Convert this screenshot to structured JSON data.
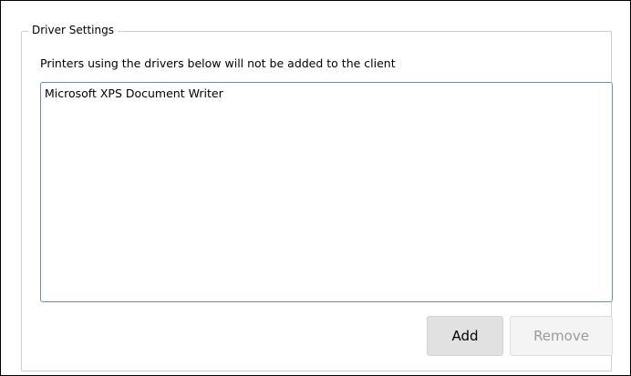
{
  "group": {
    "title": "Driver Settings",
    "description": "Printers using the drivers below will not be added to the client"
  },
  "driver_list": {
    "items": [
      "Microsoft XPS Document Writer"
    ]
  },
  "buttons": {
    "add_label": "Add",
    "remove_label": "Remove",
    "remove_enabled": false
  }
}
